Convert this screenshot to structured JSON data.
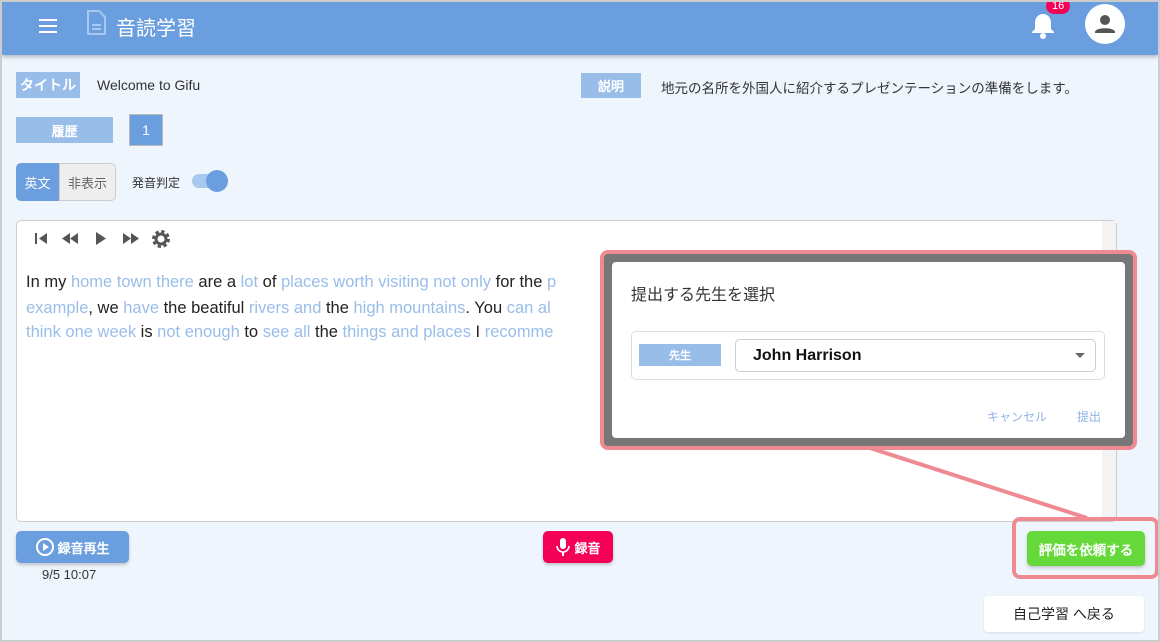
{
  "header": {
    "app_title": "音読学習",
    "notification_count": "16",
    "icons": [
      "menu-icon",
      "document-icon",
      "bell-icon",
      "account-icon"
    ]
  },
  "info": {
    "title_label": "タイトル",
    "title_value": "Welcome to Gifu",
    "description_label": "説明",
    "description_value": "地元の名所を外国人に紹介するプレゼンテーションの準備をします。",
    "history_label": "履歴",
    "history_value": "1"
  },
  "controls": {
    "toggle_english": "英文",
    "toggle_hide": "非表示",
    "pronunciation_label": "発音判定",
    "pronunciation_on": true
  },
  "text_lines": [
    [
      {
        "t": "In my ",
        "h": false
      },
      {
        "t": "home town there",
        "h": true
      },
      {
        "t": " are a ",
        "h": false
      },
      {
        "t": "lot",
        "h": true
      },
      {
        "t": " of ",
        "h": false
      },
      {
        "t": "places worth visiting not only",
        "h": true
      },
      {
        "t": " for the ",
        "h": false
      },
      {
        "t": "p",
        "h": true
      }
    ],
    [
      {
        "t": "example",
        "h": true
      },
      {
        "t": ", we ",
        "h": false
      },
      {
        "t": "have",
        "h": true
      },
      {
        "t": " the beatiful ",
        "h": false
      },
      {
        "t": "rivers and",
        "h": true
      },
      {
        "t": " the ",
        "h": false
      },
      {
        "t": "high mountains",
        "h": true
      },
      {
        "t": ". You ",
        "h": false
      },
      {
        "t": "can al",
        "h": true
      }
    ],
    [
      {
        "t": "think one week",
        "h": true
      },
      {
        "t": " is ",
        "h": false
      },
      {
        "t": "not enough",
        "h": true
      },
      {
        "t": " to ",
        "h": false
      },
      {
        "t": "see all",
        "h": true
      },
      {
        "t": " the ",
        "h": false
      },
      {
        "t": "things and places",
        "h": true
      },
      {
        "t": " I ",
        "h": false
      },
      {
        "t": "recomme",
        "h": true
      }
    ]
  ],
  "bottom": {
    "playback_label": "録音再生",
    "playback_time": "9/5 10:07",
    "record_label": "録音",
    "request_label": "評価を依頼する",
    "back_label": "自己学習 へ戻る"
  },
  "dialog": {
    "title": "提出する先生を選択",
    "teacher_label": "先生",
    "teacher_value": "John Harrison",
    "cancel_label": "キャンセル",
    "submit_label": "提出"
  },
  "colors": {
    "primary": "#6b9ede",
    "highlight": "#99bde9",
    "record": "#f50057",
    "request": "#66d93a",
    "annotation": "#ef8a92"
  }
}
